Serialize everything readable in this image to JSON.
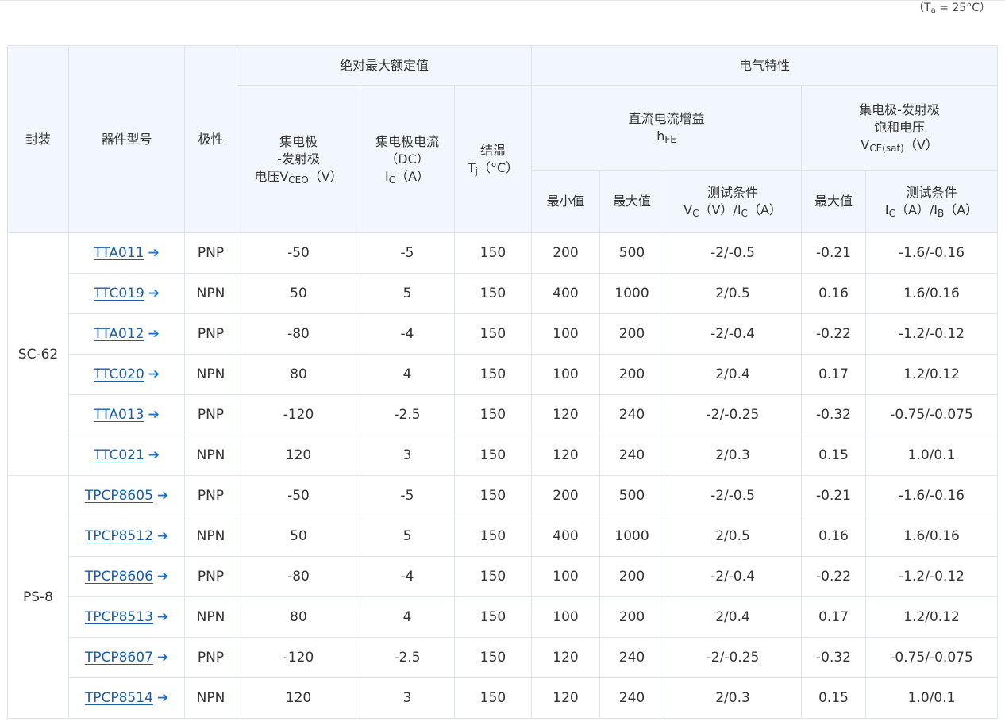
{
  "note": {
    "pre": "（T",
    "sub": "a",
    "post": " = 25°C）"
  },
  "headers": {
    "package": "封装",
    "part": "器件型号",
    "polarity": "极性",
    "abs_max": "绝对最大额定值",
    "electrical": "电气特性",
    "vceo": {
      "line1": "集电极",
      "line2": "-发射极",
      "line3_pre": "电压V",
      "line3_sub": "CEO",
      "line3_post": "（V）"
    },
    "ic": {
      "line1": "集电极电流",
      "line2": "（DC）",
      "line3_pre": "I",
      "line3_sub": "C",
      "line3_post": "（A）"
    },
    "tj": {
      "line1": "结温",
      "line2_pre": "T",
      "line2_sub": "j",
      "line2_post": "（°C）"
    },
    "hfe": {
      "line1": "直流电流增益",
      "line2_pre": "h",
      "line2_sub": "FE"
    },
    "vcesat": {
      "line1": "集电极-发射极",
      "line2": "饱和电压",
      "line3_pre": "V",
      "line3_sub": "CE(sat)",
      "line3_post": "（V）"
    },
    "min": "最小值",
    "max": "最大值",
    "max2": "最大值",
    "test1": {
      "line1": "测试条件",
      "p1": "V",
      "s1": "C",
      "p2": "（V）/I",
      "s2": "C",
      "p3": "（A）"
    },
    "test2": {
      "line1": "测试条件",
      "p1": "I",
      "s1": "C",
      "p2": "（A）/I",
      "s2": "B",
      "p3": "（A）"
    }
  },
  "groups": [
    {
      "package": "SC-62",
      "rows": [
        {
          "part": "TTA011",
          "polarity": "PNP",
          "vceo": "-50",
          "ic": "-5",
          "tj": "150",
          "hfe_min": "200",
          "hfe_max": "500",
          "hfe_test": "-2/-0.5",
          "vcesat_max": "-0.21",
          "vcesat_test": "-1.6/-0.16"
        },
        {
          "part": "TTC019",
          "polarity": "NPN",
          "vceo": "50",
          "ic": "5",
          "tj": "150",
          "hfe_min": "400",
          "hfe_max": "1000",
          "hfe_test": "2/0.5",
          "vcesat_max": "0.16",
          "vcesat_test": "1.6/0.16"
        },
        {
          "part": "TTA012",
          "polarity": "PNP",
          "vceo": "-80",
          "ic": "-4",
          "tj": "150",
          "hfe_min": "100",
          "hfe_max": "200",
          "hfe_test": "-2/-0.4",
          "vcesat_max": "-0.22",
          "vcesat_test": "-1.2/-0.12"
        },
        {
          "part": "TTC020",
          "polarity": "NPN",
          "vceo": "80",
          "ic": "4",
          "tj": "150",
          "hfe_min": "100",
          "hfe_max": "200",
          "hfe_test": "2/0.4",
          "vcesat_max": "0.17",
          "vcesat_test": "1.2/0.12"
        },
        {
          "part": "TTA013",
          "polarity": "PNP",
          "vceo": "-120",
          "ic": "-2.5",
          "tj": "150",
          "hfe_min": "120",
          "hfe_max": "240",
          "hfe_test": "-2/-0.25",
          "vcesat_max": "-0.32",
          "vcesat_test": "-0.75/-0.075"
        },
        {
          "part": "TTC021",
          "polarity": "NPN",
          "vceo": "120",
          "ic": "3",
          "tj": "150",
          "hfe_min": "120",
          "hfe_max": "240",
          "hfe_test": "2/0.3",
          "vcesat_max": "0.15",
          "vcesat_test": "1.0/0.1"
        }
      ]
    },
    {
      "package": "PS-8",
      "rows": [
        {
          "part": "TPCP8605",
          "polarity": "PNP",
          "vceo": "-50",
          "ic": "-5",
          "tj": "150",
          "hfe_min": "200",
          "hfe_max": "500",
          "hfe_test": "-2/-0.5",
          "vcesat_max": "-0.21",
          "vcesat_test": "-1.6/-0.16"
        },
        {
          "part": "TPCP8512",
          "polarity": "NPN",
          "vceo": "50",
          "ic": "5",
          "tj": "150",
          "hfe_min": "400",
          "hfe_max": "1000",
          "hfe_test": "2/0.5",
          "vcesat_max": "0.16",
          "vcesat_test": "1.6/0.16"
        },
        {
          "part": "TPCP8606",
          "polarity": "PNP",
          "vceo": "-80",
          "ic": "-4",
          "tj": "150",
          "hfe_min": "100",
          "hfe_max": "200",
          "hfe_test": "-2/-0.4",
          "vcesat_max": "-0.22",
          "vcesat_test": "-1.2/-0.12"
        },
        {
          "part": "TPCP8513",
          "polarity": "NPN",
          "vceo": "80",
          "ic": "4",
          "tj": "150",
          "hfe_min": "100",
          "hfe_max": "200",
          "hfe_test": "2/0.4",
          "vcesat_max": "0.17",
          "vcesat_test": "1.2/0.12"
        },
        {
          "part": "TPCP8607",
          "polarity": "PNP",
          "vceo": "-120",
          "ic": "-2.5",
          "tj": "150",
          "hfe_min": "120",
          "hfe_max": "240",
          "hfe_test": "-2/-0.25",
          "vcesat_max": "-0.32",
          "vcesat_test": "-0.75/-0.075"
        },
        {
          "part": "TPCP8514",
          "polarity": "NPN",
          "vceo": "120",
          "ic": "3",
          "tj": "150",
          "hfe_min": "120",
          "hfe_max": "240",
          "hfe_test": "2/0.3",
          "vcesat_max": "0.15",
          "vcesat_test": "1.0/0.1"
        }
      ]
    }
  ]
}
